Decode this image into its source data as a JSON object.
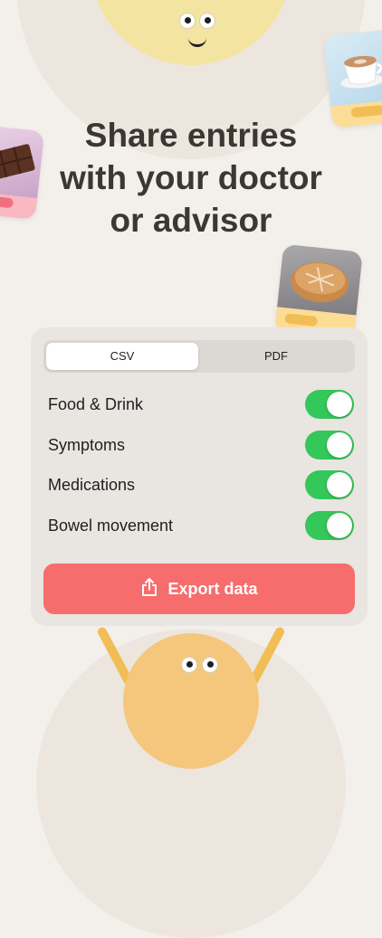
{
  "headline": {
    "line1": "Share entries",
    "line2": "with your doctor",
    "line3": "or advisor"
  },
  "format_selector": {
    "options": [
      "CSV",
      "PDF"
    ],
    "selected": "CSV"
  },
  "categories": [
    {
      "label": "Food & Drink",
      "enabled": true
    },
    {
      "label": "Symptoms",
      "enabled": true
    },
    {
      "label": "Medications",
      "enabled": true
    },
    {
      "label": "Bowel movement",
      "enabled": true
    }
  ],
  "export_button": {
    "label": "Export data",
    "icon": "share-icon"
  },
  "colors": {
    "background": "#F3F0EC",
    "toggle_on": "#34C759",
    "export_button": "#F76C6C",
    "headline": "#3B3732"
  }
}
